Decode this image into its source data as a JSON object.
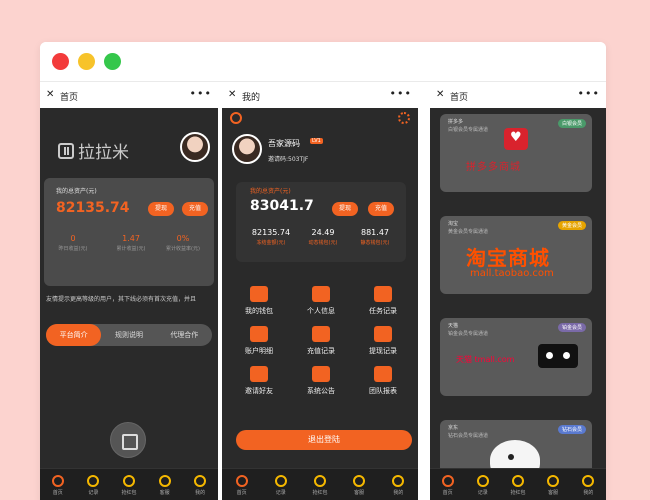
{
  "colors": {
    "accent": "#f26322",
    "dark_bg": "#2a2a2a",
    "window_bg": "#ffffff",
    "page_bg": "#fcd3cf"
  },
  "panel1": {
    "nav_title": "首页",
    "logo_text": "拉拉米",
    "assets_label": "我的总资产(元)",
    "assets_value": "82135.74",
    "withdraw": "提现",
    "recharge": "充值",
    "stats": [
      {
        "value": "0",
        "label": "昨日收益(元)"
      },
      {
        "value": "1.47",
        "label": "累计收益(元)"
      },
      {
        "value": "0%",
        "label": "累计收益率(元)"
      }
    ],
    "notice": "友情提示更高等级的用户，其下线必须有首次充值，并且",
    "tabs": [
      "平台简介",
      "规则说明",
      "代理合作"
    ]
  },
  "panel2": {
    "nav_title": "我的",
    "username": "吾家源码",
    "level": "LV1",
    "invite_code": "邀请码:503TJF",
    "assets_label": "我的总资产(元)",
    "assets_value": "83041.7",
    "withdraw": "提现",
    "recharge": "充值",
    "stats": [
      {
        "value": "82135.74",
        "label": "冻结金额(元)"
      },
      {
        "value": "24.49",
        "label": "动态钱包(元)"
      },
      {
        "value": "881.47",
        "label": "静态钱包(元)"
      }
    ],
    "grid": [
      "我的钱包",
      "个人信息",
      "任务记录",
      "账户明细",
      "充值记录",
      "提现记录",
      "邀请好友",
      "系统公告",
      "团队报表"
    ],
    "logout": "退出登陆"
  },
  "panel3": {
    "nav_title": "首页",
    "cards": [
      {
        "name": "拼多多",
        "desc": "白银会员专属通道",
        "badge": "白银会员",
        "badge_color": "#4a9a6a",
        "brand": "拼多多商城"
      },
      {
        "name": "淘宝",
        "desc": "黄金会员专属通道",
        "badge": "黄金会员",
        "badge_color": "#e6a400",
        "brand": "淘宝商城",
        "url": "mall.taobao.com"
      },
      {
        "name": "天猫",
        "desc": "铂金会员专属通道",
        "badge": "铂金会员",
        "badge_color": "#7a6aa8",
        "brand": "天猫 tmall.com"
      },
      {
        "name": "京东",
        "desc": "钻石会员专属通道",
        "badge": "钻石会员",
        "badge_color": "#5a7ad0"
      }
    ]
  },
  "tabbar": [
    "首页",
    "记录",
    "抢红包",
    "客服",
    "我的"
  ]
}
